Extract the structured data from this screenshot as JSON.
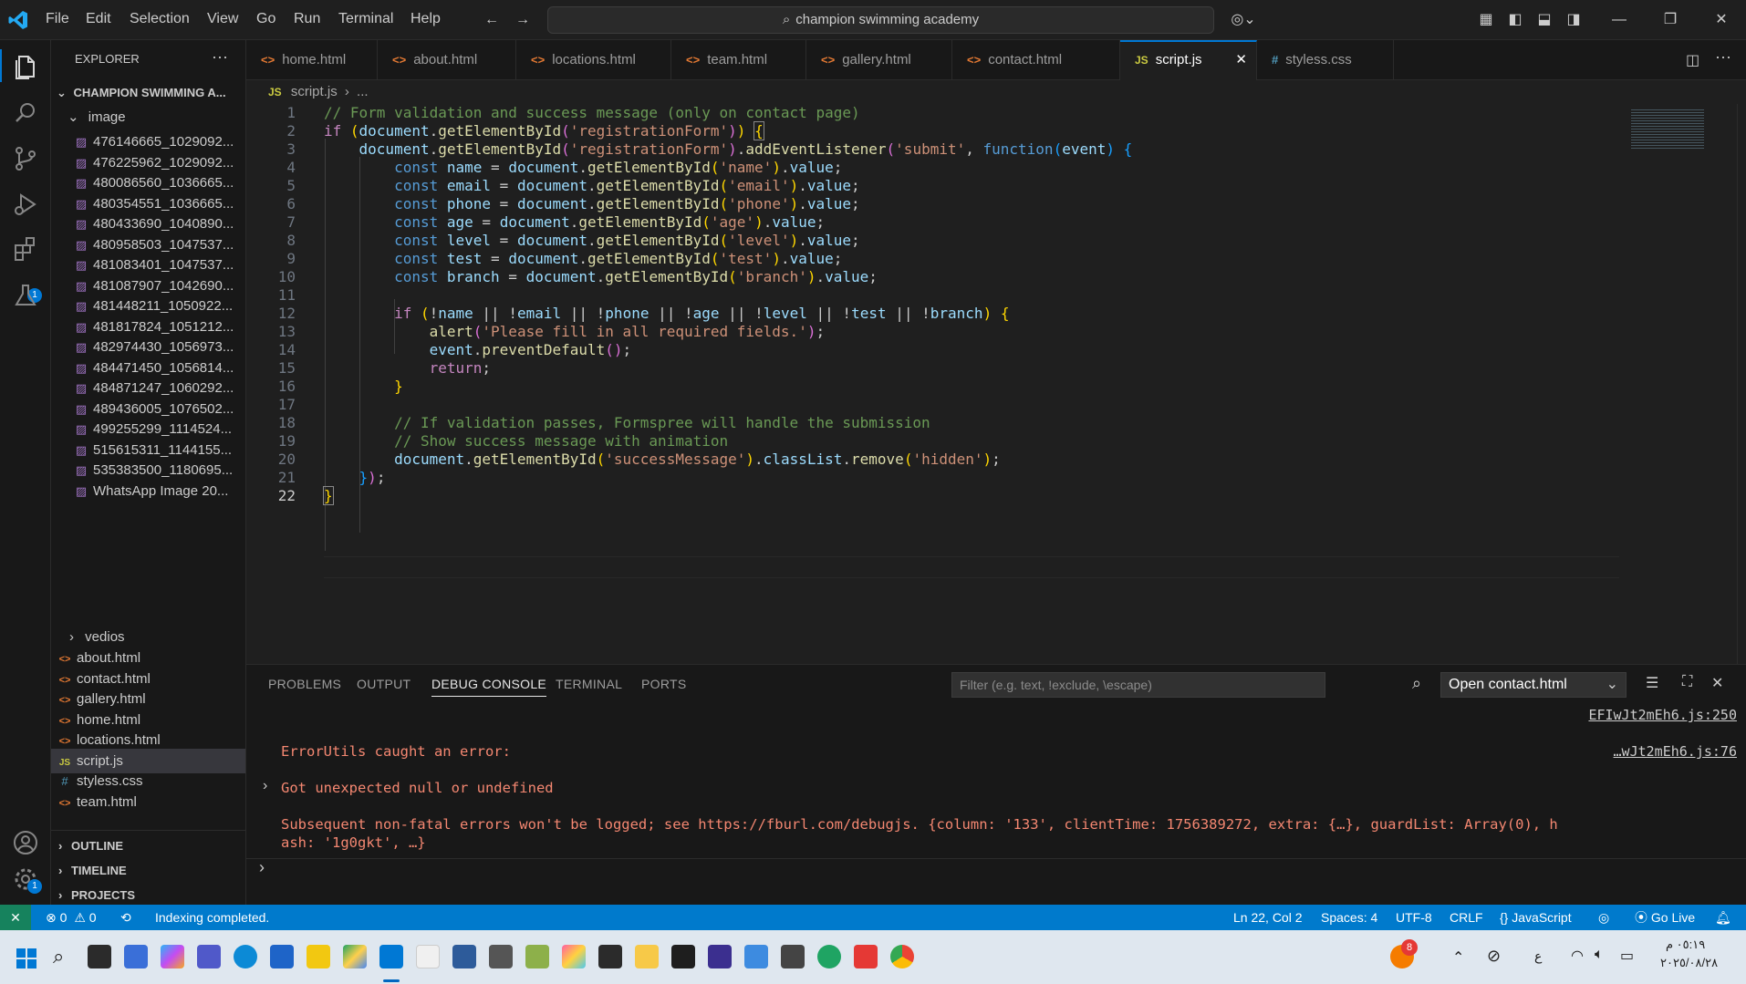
{
  "titlebar": {
    "menus": [
      "File",
      "Edit",
      "Selection",
      "View",
      "Go",
      "Run",
      "Terminal",
      "Help"
    ],
    "search": "champion swimming academy"
  },
  "sidebar": {
    "title": "EXPLORER",
    "root": "CHAMPION SWIMMING A...",
    "folder_image": "image",
    "images": [
      "476146665_1029092...",
      "476225962_1029092...",
      "480086560_1036665...",
      "480354551_1036665...",
      "480433690_1040890...",
      "480958503_1047537...",
      "481083401_1047537...",
      "481087907_1042690...",
      "481448211_1050922...",
      "481817824_1051212...",
      "482974430_1056973...",
      "484471450_1056814...",
      "484871247_1060292...",
      "489436005_1076502...",
      "499255299_1114524...",
      "515615311_1144155...",
      "535383500_1180695...",
      "WhatsApp Image 20..."
    ],
    "folder_videos": "vedios",
    "files": [
      "about.html",
      "contact.html",
      "gallery.html",
      "home.html",
      "locations.html",
      "script.js",
      "styless.css",
      "team.html"
    ],
    "sections": [
      "OUTLINE",
      "TIMELINE",
      "PROJECTS"
    ],
    "ext_badge": "1",
    "settings_badge": "1"
  },
  "tabs": [
    "home.html",
    "about.html",
    "locations.html",
    "team.html",
    "gallery.html",
    "contact.html",
    "script.js",
    "styless.css"
  ],
  "breadcrumb": {
    "file": "script.js",
    "rest": "..."
  },
  "editor": {
    "line_numbers": [
      "1",
      "2",
      "3",
      "4",
      "5",
      "6",
      "7",
      "8",
      "9",
      "10",
      "11",
      "12",
      "13",
      "14",
      "15",
      "16",
      "17",
      "18",
      "19",
      "20",
      "21",
      "22"
    ]
  },
  "panel": {
    "tabs": [
      "PROBLEMS",
      "OUTPUT",
      "DEBUG CONSOLE",
      "TERMINAL",
      "PORTS"
    ],
    "filter_placeholder": "Filter (e.g. text, !exclude, \\escape)",
    "session": "Open contact.html",
    "src1": "EFIwJt2mEh6.js:250",
    "src2": "…wJt2mEh6.js:76",
    "err1": "ErrorUtils caught an error:",
    "err2": "Got unexpected null or undefined",
    "err3": "Subsequent non-fatal errors won't be logged; see https://fburl.com/debugjs. {column: '133', clientTime: 1756389272, extra: {…}, guardList: Array(0), h",
    "err4": "ash: '1g0gkt', …}"
  },
  "statusbar": {
    "errors": "0",
    "warnings": "0",
    "message": "Indexing completed.",
    "position": "Ln 22, Col 2",
    "spaces": "Spaces: 4",
    "encoding": "UTF-8",
    "eol": "CRLF",
    "language": "JavaScript",
    "golive": "Go Live"
  },
  "taskbar": {
    "notification_badge": "8",
    "lang": "ع",
    "time": "٠٥:١٩ م",
    "date": "٢٠٢٥/٠٨/٢٨"
  },
  "colors": {
    "accent": "#007acc",
    "tab_active_border": "#0078d4",
    "error_text": "#f48771"
  }
}
